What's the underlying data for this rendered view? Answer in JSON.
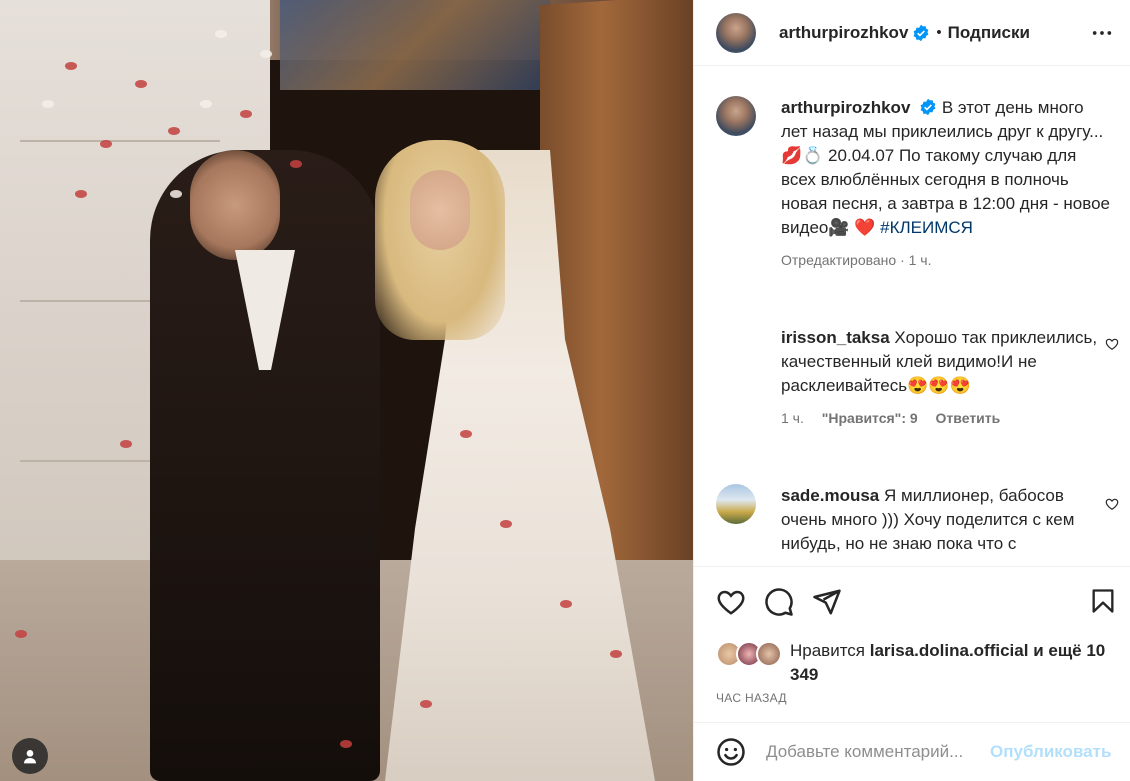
{
  "post": {
    "author": "arthurpirozhkov",
    "follow_label": "Подписки",
    "dot": "•",
    "caption": {
      "text": "В этот день много лет назад мы приклеились друг к другу...💋💍 20.04.07 По такому случаю для всех влюблённых сегодня в полночь новая песня, а завтра в 12:00 дня - новое видео🎥",
      "heart": "❤️",
      "hashtag": "#КЛЕИМСЯ",
      "meta": "Отредактировано · 1 ч."
    }
  },
  "comments": [
    {
      "user": "irisson_taksa",
      "text": "Хорошо так приклеились, качественный клей видимо!И не расклеивайтесь😍😍😍",
      "time": "1 ч.",
      "likes": "\"Нравится\": 9",
      "reply": "Ответить"
    },
    {
      "user": "sade.mousa",
      "text": "Я миллионер, бабосов очень много ))) Хочу поделится с кем нибудь, но не знаю пока что с"
    }
  ],
  "likes": {
    "prefix": "Нравится ",
    "user": "larisa.dolina.official",
    "suffix": " и ещё 10 349"
  },
  "time_ago": "ЧАС НАЗАД",
  "add_comment": {
    "placeholder": "Добавьте комментарий...",
    "publish": "Опубликовать"
  },
  "colors": {
    "verified": "#0095f6",
    "hashtag": "#00376b",
    "publish": "#b2dffc",
    "secondary_text": "#737373"
  },
  "icons": [
    "verified-badge-icon",
    "more-options-icon",
    "heart-icon",
    "comment-icon",
    "share-icon",
    "bookmark-icon",
    "emoji-icon",
    "user-tag-icon"
  ]
}
